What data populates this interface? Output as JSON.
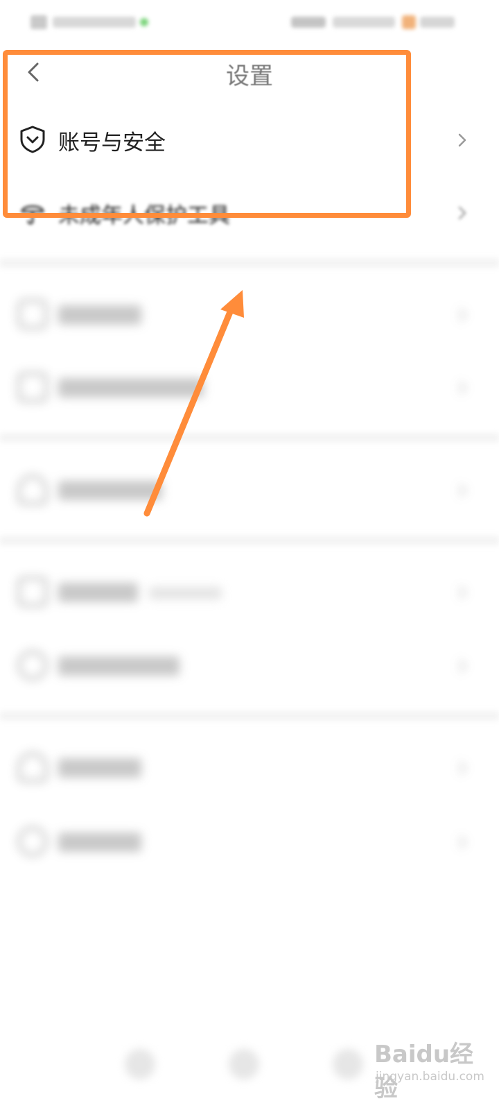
{
  "header": {
    "title": "设置"
  },
  "sections": [
    {
      "items": [
        {
          "label": "账号与安全",
          "icon": "shield-icon"
        },
        {
          "label": "未成年人保护工具",
          "icon": "umbrella-icon"
        }
      ]
    },
    {
      "items": [
        {
          "label": "",
          "icon": "settings-icon"
        },
        {
          "label": "",
          "icon": "lock-icon"
        }
      ]
    },
    {
      "items": [
        {
          "label": "",
          "icon": "user-icon"
        }
      ]
    },
    {
      "items": [
        {
          "label": "",
          "icon": "storage-icon",
          "sub": ""
        },
        {
          "label": "",
          "icon": "info-icon"
        }
      ]
    },
    {
      "items": [
        {
          "label": "",
          "icon": "switch-account-icon"
        },
        {
          "label": "",
          "icon": "logout-icon"
        }
      ]
    }
  ],
  "watermark": {
    "brand": "Baidu经验",
    "url": "jingyan.baidu.com"
  },
  "colors": {
    "highlight": "#ff8c3a"
  }
}
